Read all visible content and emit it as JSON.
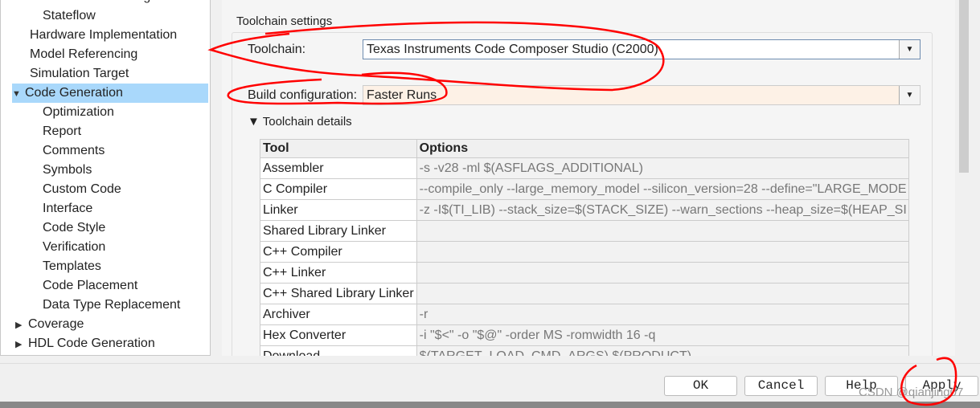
{
  "sidebar": {
    "items": [
      {
        "label": "Model Referencing",
        "indent": 2,
        "expander": ""
      },
      {
        "label": "Stateflow",
        "indent": 2,
        "expander": ""
      },
      {
        "label": "Hardware Implementation",
        "indent": 1,
        "expander": ""
      },
      {
        "label": "Model Referencing",
        "indent": 1,
        "expander": ""
      },
      {
        "label": "Simulation Target",
        "indent": 1,
        "expander": ""
      },
      {
        "label": "Code Generation",
        "indent": 1,
        "expander": "▼",
        "selected": true
      },
      {
        "label": "Optimization",
        "indent": 2,
        "expander": ""
      },
      {
        "label": "Report",
        "indent": 2,
        "expander": ""
      },
      {
        "label": "Comments",
        "indent": 2,
        "expander": ""
      },
      {
        "label": "Symbols",
        "indent": 2,
        "expander": ""
      },
      {
        "label": "Custom Code",
        "indent": 2,
        "expander": ""
      },
      {
        "label": "Interface",
        "indent": 2,
        "expander": ""
      },
      {
        "label": "Code Style",
        "indent": 2,
        "expander": ""
      },
      {
        "label": "Verification",
        "indent": 2,
        "expander": ""
      },
      {
        "label": "Templates",
        "indent": 2,
        "expander": ""
      },
      {
        "label": "Code Placement",
        "indent": 2,
        "expander": ""
      },
      {
        "label": "Data Type Replacement",
        "indent": 2,
        "expander": ""
      },
      {
        "label": "Coverage",
        "indent": 0,
        "expander": "▶"
      },
      {
        "label": "HDL Code Generation",
        "indent": 0,
        "expander": "▶"
      }
    ]
  },
  "main": {
    "section_title": "Toolchain settings",
    "toolchain_label": "Toolchain:",
    "toolchain_value": "Texas Instruments Code Composer Studio (C2000)",
    "build_label": "Build configuration:",
    "build_value": "Faster Runs",
    "details_title": "▼ Toolchain details",
    "table": {
      "headers": [
        "Tool",
        "Options"
      ],
      "rows": [
        [
          "Assembler",
          "-s -v28 -ml $(ASFLAGS_ADDITIONAL)"
        ],
        [
          "C Compiler",
          " --compile_only --large_memory_model --silicon_version=28 --define=\"LARGE_MODE"
        ],
        [
          "Linker",
          "-z -I$(TI_LIB) --stack_size=$(STACK_SIZE) --warn_sections --heap_size=$(HEAP_SI"
        ],
        [
          "Shared Library Linker",
          ""
        ],
        [
          "C++ Compiler",
          ""
        ],
        [
          "C++ Linker",
          ""
        ],
        [
          "C++ Shared Library Linker",
          ""
        ],
        [
          "Archiver",
          "-r"
        ],
        [
          "Hex Converter",
          " -i \"$<\" -o \"$@\" -order MS -romwidth 16 -q"
        ],
        [
          "Download",
          "$(TARGET_LOAD_CMD_ARGS) $(PRODUCT)"
        ]
      ]
    }
  },
  "buttons": {
    "ok": "OK",
    "cancel": "Cancel",
    "help": "Help",
    "apply": "Apply"
  },
  "watermark": "CSDN @qianjing07",
  "colors": {
    "selection": "#a9d8fb",
    "annotation": "#ff0000",
    "build_field": "#fdf1e6"
  }
}
